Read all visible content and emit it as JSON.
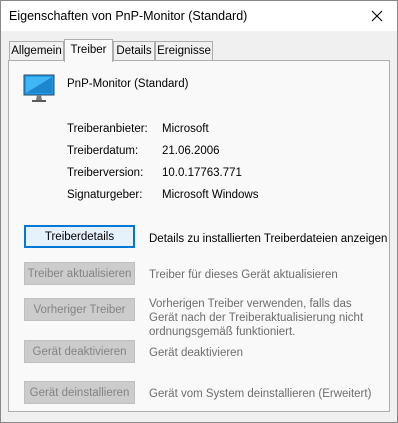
{
  "window": {
    "title": "Eigenschaften von PnP-Monitor (Standard)"
  },
  "tabs": [
    {
      "label": "Allgemein",
      "active": false
    },
    {
      "label": "Treiber",
      "active": true
    },
    {
      "label": "Details",
      "active": false
    },
    {
      "label": "Ereignisse",
      "active": false
    }
  ],
  "device": {
    "name": "PnP-Monitor (Standard)",
    "icon": "monitor-icon"
  },
  "info": [
    {
      "label": "Treiberanbieter:",
      "value": "Microsoft"
    },
    {
      "label": "Treiberdatum:",
      "value": "21.06.2006"
    },
    {
      "label": "Treiberversion:",
      "value": "10.0.17763.771"
    },
    {
      "label": "Signaturgeber:",
      "value": "Microsoft Windows"
    }
  ],
  "actions": [
    {
      "button": "Treiberdetails",
      "enabled": true,
      "description": "Details zu installierten Treiberdateien anzeigen"
    },
    {
      "button": "Treiber aktualisieren",
      "enabled": false,
      "description": "Treiber für dieses Gerät aktualisieren"
    },
    {
      "button": "Vorheriger Treiber",
      "enabled": false,
      "description": "Vorherigen Treiber verwenden, falls das Gerät nach der Treiberaktualisierung nicht ordnungsgemäß funktioniert."
    },
    {
      "button": "Gerät deaktivieren",
      "enabled": false,
      "description": "Gerät deaktivieren"
    },
    {
      "button": "Gerät deinstallieren",
      "enabled": false,
      "description": "Gerät vom System deinstallieren (Erweitert)"
    }
  ]
}
